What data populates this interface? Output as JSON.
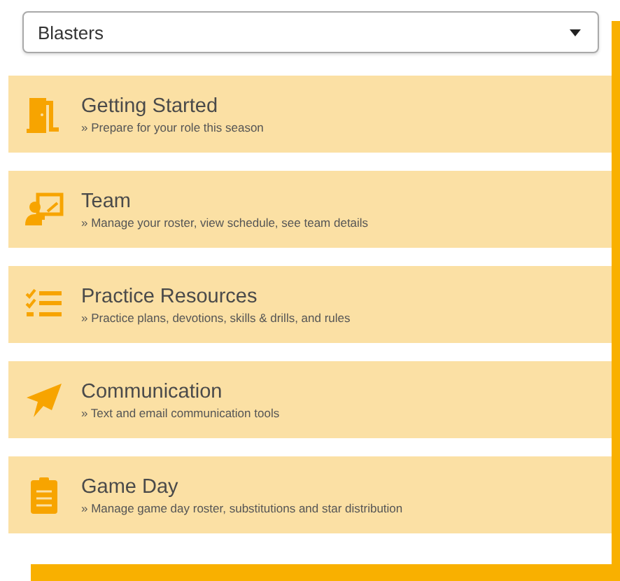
{
  "team_select": {
    "value": "Blasters"
  },
  "menu_items": [
    {
      "title": "Getting Started",
      "subtitle": "» Prepare for your role this season"
    },
    {
      "title": "Team",
      "subtitle": "» Manage your roster, view schedule, see team details"
    },
    {
      "title": "Practice Resources",
      "subtitle": "» Practice plans, devotions, skills & drills, and rules"
    },
    {
      "title": "Communication",
      "subtitle": "» Text and email communication tools"
    },
    {
      "title": "Game Day",
      "subtitle": "» Manage game day roster, substitutions and star distribution"
    }
  ]
}
